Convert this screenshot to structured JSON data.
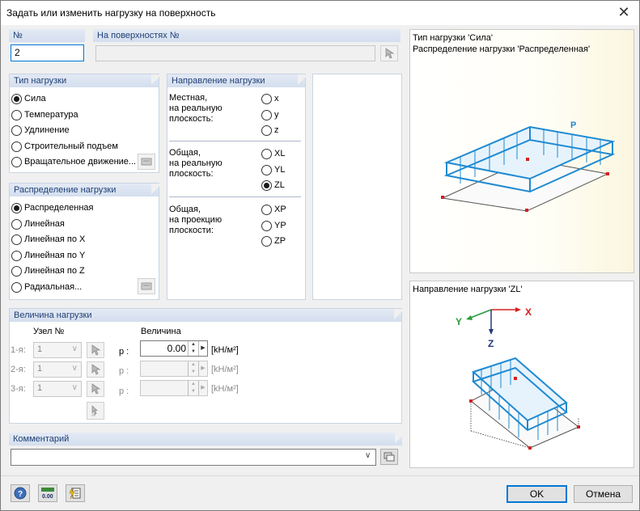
{
  "window": {
    "title": "Задать или изменить нагрузку на поверхность",
    "close_symbol": "✕"
  },
  "number": {
    "label": "№",
    "value": "2"
  },
  "surfaces": {
    "label": "На поверхностях №",
    "value": ""
  },
  "load_type": {
    "label": "Тип нагрузки",
    "options": [
      "Сила",
      "Температура",
      "Удлинение",
      "Строительный подъем",
      "Вращательное движение..."
    ],
    "selected": 0
  },
  "direction": {
    "label": "Направление нагрузки",
    "local_label": "Местная,\nна реальную\nплоскость:",
    "local_opts": [
      "x",
      "y",
      "z"
    ],
    "global_true_label": "Общая,\nна реальную\nплоскость:",
    "global_true_opts": [
      "XL",
      "YL",
      "ZL"
    ],
    "global_proj_label": "Общая,\nна проекцию\nплоскости:",
    "global_proj_opts": [
      "XP",
      "YP",
      "ZP"
    ],
    "selected": "ZL"
  },
  "distribution": {
    "label": "Распределение нагрузки",
    "options": [
      "Распределенная",
      "Линейная",
      "Линейная по X",
      "Линейная по Y",
      "Линейная по Z",
      "Радиальная..."
    ],
    "selected": 0
  },
  "magnitude": {
    "label": "Величина нагрузки",
    "node_header": "Узел №",
    "value_header": "Величина",
    "rows": [
      {
        "label": "1-я:",
        "node": "1",
        "param": "p :",
        "value": "0.00",
        "unit": "[kH/м²]",
        "enabled": true
      },
      {
        "label": "2-я:",
        "node": "1",
        "param": "p :",
        "value": "",
        "unit": "[kH/м²]",
        "enabled": false
      },
      {
        "label": "3-я:",
        "node": "1",
        "param": "p :",
        "value": "",
        "unit": "[kH/м²]",
        "enabled": false
      }
    ]
  },
  "comment": {
    "label": "Комментарий",
    "value": ""
  },
  "preview_top": {
    "line1": "Тип нагрузки 'Сила'",
    "line2": "Распределение нагрузки  'Распределенная'",
    "p_label": "P"
  },
  "preview_bottom": {
    "line1": "Направление нагрузки 'ZL'",
    "axis_x": "X",
    "axis_y": "Y",
    "axis_z": "Z"
  },
  "footer": {
    "ok": "OK",
    "cancel": "Отмена"
  },
  "colors": {
    "accent": "#0078d7",
    "load_blue": "#1f8ad2",
    "group_header": "#1e3f74",
    "node_red": "#d62020"
  }
}
